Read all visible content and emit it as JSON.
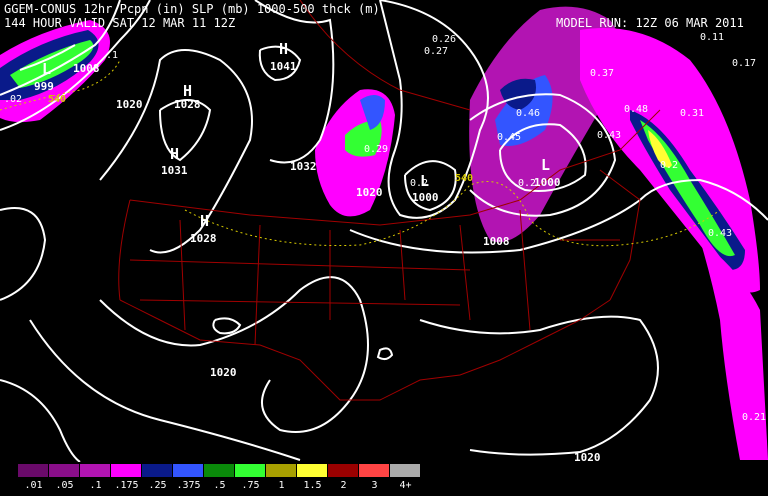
{
  "header": {
    "title_line1": "GGEM-CONUS 12hr Pcpn (in) SLP (mb) 1000-500 thck (m)",
    "title_line2": "144 HOUR VALID SAT 12 MAR 11 12Z",
    "model_run": "MODEL RUN: 12Z 06 MAR 2011"
  },
  "pressure_labels": {
    "c999": "999",
    "c1008a": "1008",
    "c1020a": "1020",
    "c1028a": "1028",
    "c1031": "1031",
    "c1028b": "1028",
    "c1041": "1041",
    "c1032": "1032",
    "c1020b": "1020",
    "c1000a": "1000",
    "c1000b": "1000",
    "c1008b": "1008",
    "c1020c": "1020",
    "c1020d": "1020"
  },
  "centers": {
    "h1": "H",
    "h2": "H",
    "h3": "H",
    "h4": "H",
    "l1": "L",
    "l2": "L",
    "l3": "L"
  },
  "precip_amounts": {
    "a1": "0.26",
    "a2": "0.27",
    "a3": "0.37",
    "a4": "0.11",
    "a5": "0.17",
    "a6": "0.46",
    "a7": "0.48",
    "a8": "0.31",
    "a9": "0.45",
    "a10": "0.43",
    "a11": "0.29",
    "a12": "0.2",
    "a13": "0.43",
    "a14": "0.2",
    "a15": "0.21",
    "a16": ".02",
    "a17": ".1",
    "a18": "0.2"
  },
  "thickness_labels": {
    "t1": "540",
    "t2": "540"
  },
  "legend": {
    "items": [
      {
        "label": ".01",
        "color": "#6a0a6a"
      },
      {
        "label": ".05",
        "color": "#8a0e8a"
      },
      {
        "label": ".1",
        "color": "#b214b2"
      },
      {
        "label": ".175",
        "color": "#ff00ff"
      },
      {
        "label": ".25",
        "color": "#0a1a8a"
      },
      {
        "label": ".375",
        "color": "#3355ff"
      },
      {
        "label": ".5",
        "color": "#0a8a0a"
      },
      {
        "label": ".75",
        "color": "#33ff33"
      },
      {
        "label": "1",
        "color": "#a8a000"
      },
      {
        "label": "1.5",
        "color": "#ffff33"
      },
      {
        "label": "2",
        "color": "#9a0000"
      },
      {
        "label": "3",
        "color": "#ff4444"
      },
      {
        "label": "4+",
        "color": "#aaaaaa"
      }
    ]
  },
  "colors": {
    "isobar": "#ffffff",
    "border": "#a00000",
    "thickness": "#d6c800"
  }
}
